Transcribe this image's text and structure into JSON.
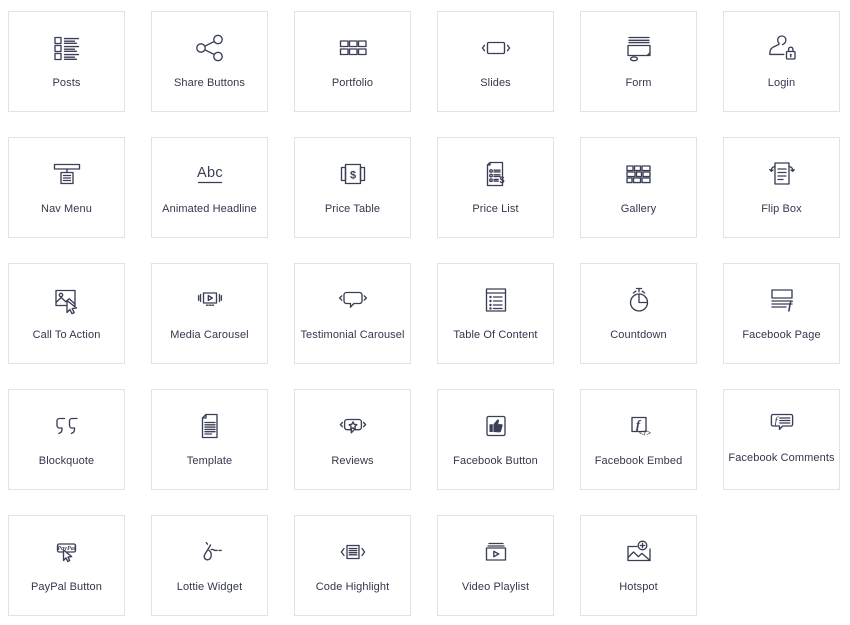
{
  "theme": {
    "background": "#ffffff",
    "card_border": "#e2e2e4",
    "icon_color": "#3a3f56",
    "label_color": "#33374d"
  },
  "grid": {
    "columns": 6,
    "rows": 5,
    "widget_count": 29
  },
  "widgets": [
    {
      "label": "Posts",
      "icon": "posts-icon"
    },
    {
      "label": "Share Buttons",
      "icon": "share-buttons-icon"
    },
    {
      "label": "Portfolio",
      "icon": "portfolio-icon"
    },
    {
      "label": "Slides",
      "icon": "slides-icon"
    },
    {
      "label": "Form",
      "icon": "form-icon"
    },
    {
      "label": "Login",
      "icon": "login-icon"
    },
    {
      "label": "Nav Menu",
      "icon": "nav-menu-icon"
    },
    {
      "label": "Animated Headline",
      "icon": "animated-headline-icon"
    },
    {
      "label": "Price Table",
      "icon": "price-table-icon"
    },
    {
      "label": "Price List",
      "icon": "price-list-icon"
    },
    {
      "label": "Gallery",
      "icon": "gallery-icon"
    },
    {
      "label": "Flip Box",
      "icon": "flip-box-icon"
    },
    {
      "label": "Call To Action",
      "icon": "call-to-action-icon"
    },
    {
      "label": "Media Carousel",
      "icon": "media-carousel-icon"
    },
    {
      "label": "Testimonial Carousel",
      "icon": "testimonial-carousel-icon"
    },
    {
      "label": "Table Of Content",
      "icon": "table-of-content-icon"
    },
    {
      "label": "Countdown",
      "icon": "countdown-icon"
    },
    {
      "label": "Facebook Page",
      "icon": "facebook-page-icon"
    },
    {
      "label": "Blockquote",
      "icon": "blockquote-icon"
    },
    {
      "label": "Template",
      "icon": "template-icon"
    },
    {
      "label": "Reviews",
      "icon": "reviews-icon"
    },
    {
      "label": "Facebook Button",
      "icon": "facebook-button-icon"
    },
    {
      "label": "Facebook Embed",
      "icon": "facebook-embed-icon"
    },
    {
      "label": "Facebook Comments",
      "icon": "facebook-comments-icon",
      "two_line": true
    },
    {
      "label": "PayPal Button",
      "icon": "paypal-button-icon",
      "glyph_text": "PayPal"
    },
    {
      "label": "Lottie Widget",
      "icon": "lottie-widget-icon"
    },
    {
      "label": "Code Highlight",
      "icon": "code-highlight-icon"
    },
    {
      "label": "Video Playlist",
      "icon": "video-playlist-icon"
    },
    {
      "label": "Hotspot",
      "icon": "hotspot-icon"
    }
  ]
}
